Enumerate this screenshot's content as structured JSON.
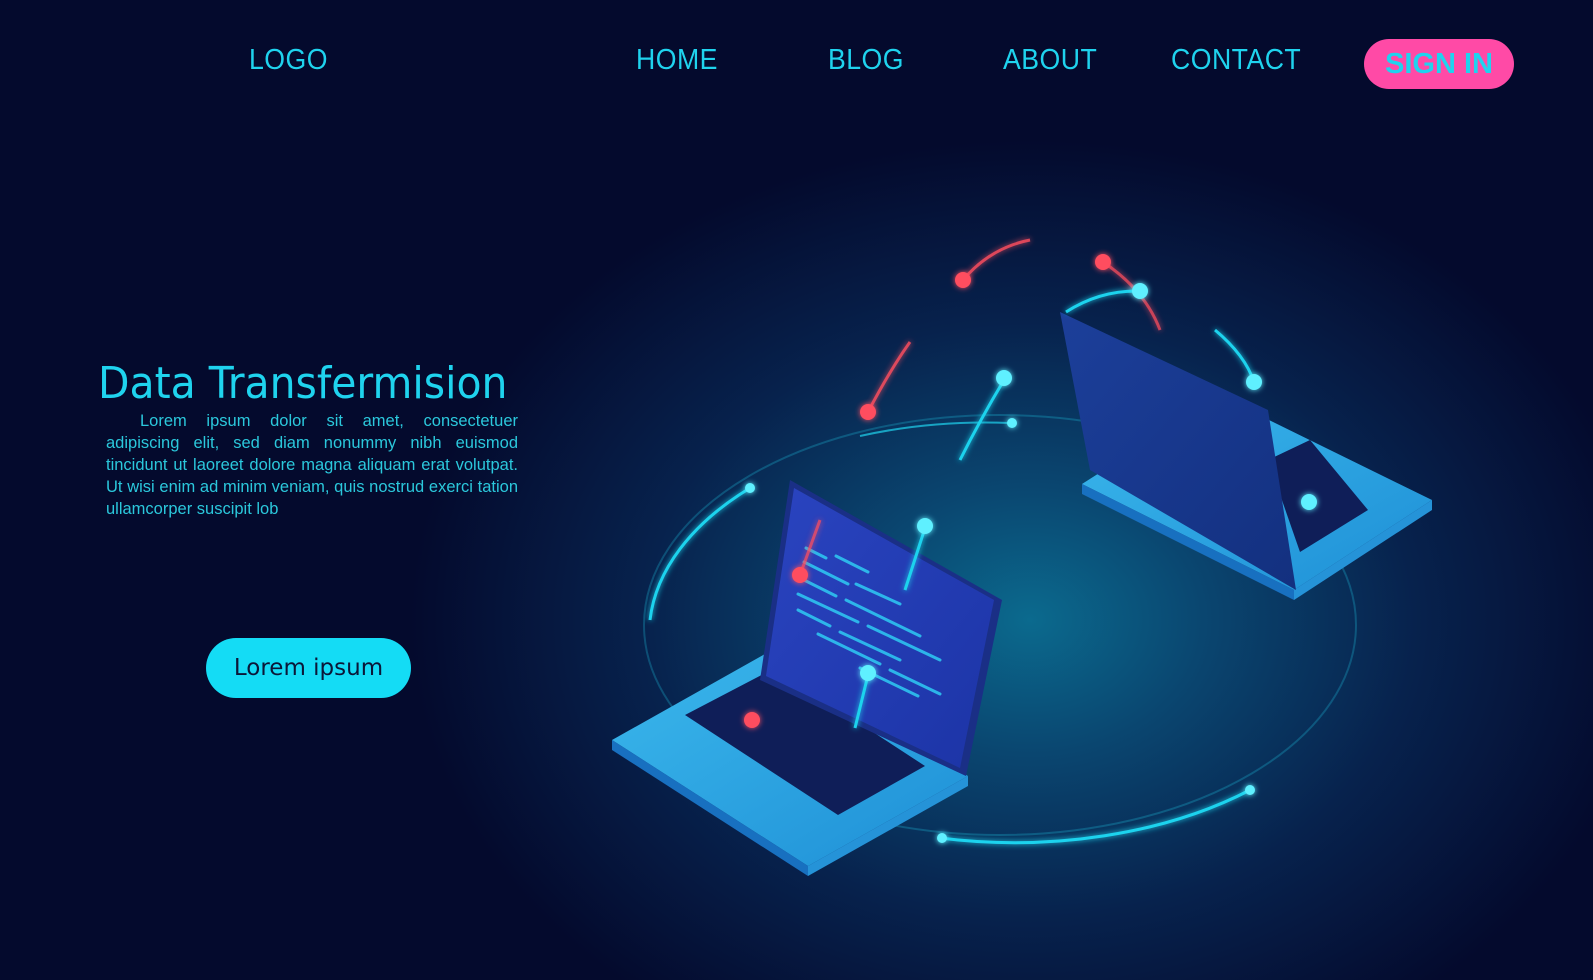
{
  "header": {
    "logo": "LOGO",
    "nav": [
      {
        "label": "HOME"
      },
      {
        "label": "BLOG"
      },
      {
        "label": "ABOUT"
      },
      {
        "label": "CONTACT"
      }
    ],
    "sign_in_label": "SIGN IN"
  },
  "hero": {
    "title": "Data Transfermision",
    "body": "Lorem ipsum dolor sit amet, consectetuer adipiscing elit, sed diam nonummy nibh euismod tincidunt ut laoreet dolore magna aliquam erat volutpat. Ut wisi enim ad minim veniam, quis nostrud exerci tation ullamcorper suscipit lob",
    "cta_label": "Lorem ipsum"
  },
  "illustration": {
    "description": "Isometric illustration of two laptops exchanging data over a glowing orbit",
    "colors": {
      "accent_cyan": "#1fd3ee",
      "accent_pink": "#ff4aa6",
      "node_red": "#ff4d5e",
      "screen_blue": "#1f3fb8",
      "laptop_body": "#2aa8e0"
    }
  }
}
